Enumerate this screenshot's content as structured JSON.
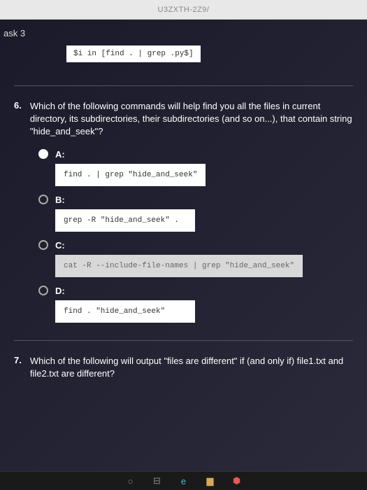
{
  "browser": {
    "url_fragment": "U3ZXTH-2Z9/"
  },
  "task": {
    "label": "ask 3",
    "code_snippet": "$i in [find . | grep .py$]"
  },
  "question6": {
    "number": "6.",
    "text": "Which of the following commands will help find you all the files in current directory, its subdirectories, their subdirectories (and so on...), that contain string \"hide_and_seek\"?",
    "options": [
      {
        "label": "A:",
        "code": "find . | grep \"hide_and_seek\"",
        "selected": true
      },
      {
        "label": "B:",
        "code": "grep -R \"hide_and_seek\" .",
        "selected": false
      },
      {
        "label": "C:",
        "code": "cat -R --include-file-names | grep \"hide_and_seek\"",
        "selected": false
      },
      {
        "label": "D:",
        "code": "find . \"hide_and_seek\"",
        "selected": false
      }
    ]
  },
  "question7": {
    "number": "7.",
    "text": "Which of the following will output \"files are different\" if (and only if) file1.txt and file2.txt are different?"
  }
}
